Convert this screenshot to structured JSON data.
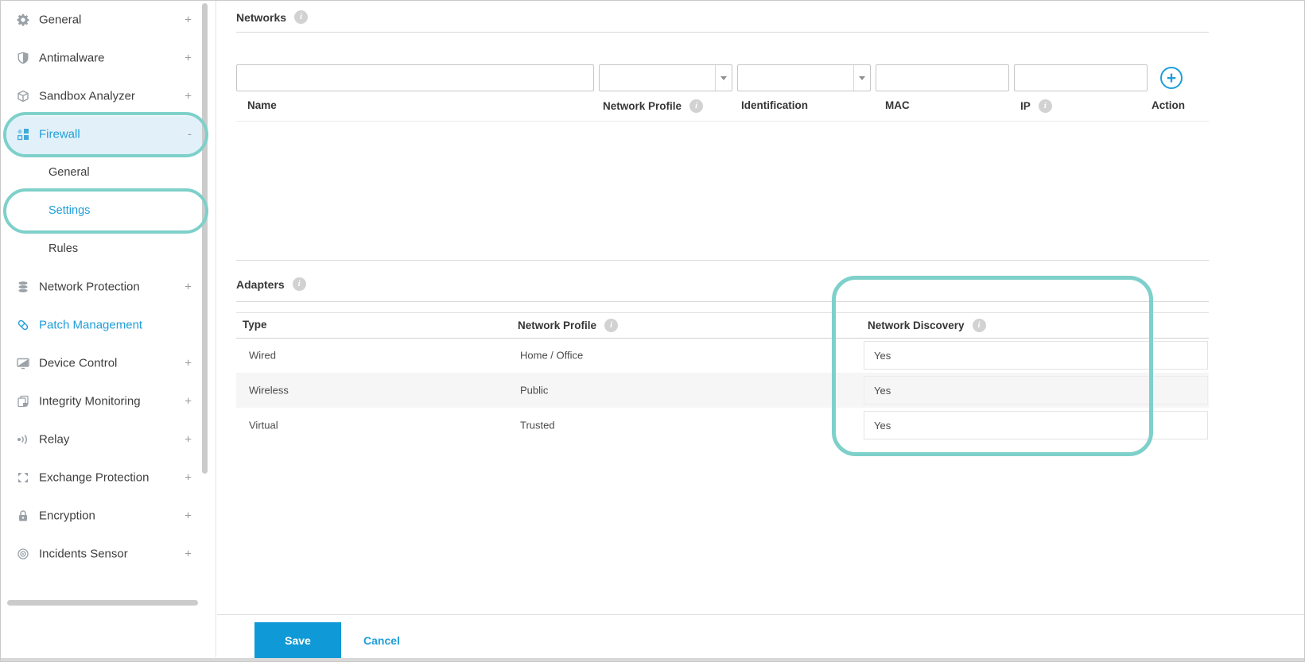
{
  "sidebar": {
    "items_top": [
      {
        "label": "General",
        "icon": "gear-icon",
        "expander": "+"
      },
      {
        "label": "Antimalware",
        "icon": "shield-icon",
        "expander": "+"
      },
      {
        "label": "Sandbox Analyzer",
        "icon": "cube-icon",
        "expander": "+"
      }
    ],
    "firewall": {
      "label": "Firewall",
      "icon": "firewall-icon",
      "expander": "-"
    },
    "firewall_children": [
      {
        "label": "General"
      },
      {
        "label": "Settings"
      },
      {
        "label": "Rules"
      }
    ],
    "items_bottom": [
      {
        "label": "Network Protection",
        "icon": "database-icon",
        "expander": "+"
      },
      {
        "label": "Patch Management",
        "icon": "patch-icon",
        "expander": ""
      },
      {
        "label": "Device Control",
        "icon": "monitor-icon",
        "expander": "+"
      },
      {
        "label": "Integrity Monitoring",
        "icon": "copy-icon",
        "expander": "+"
      },
      {
        "label": "Relay",
        "icon": "signal-icon",
        "expander": "+"
      },
      {
        "label": "Exchange Protection",
        "icon": "exchange-icon",
        "expander": "+"
      },
      {
        "label": "Encryption",
        "icon": "lock-icon",
        "expander": "+"
      },
      {
        "label": "Incidents Sensor",
        "icon": "sensor-icon",
        "expander": "+"
      }
    ]
  },
  "networks": {
    "title": "Networks",
    "headers": {
      "name": "Name",
      "network_profile": "Network Profile",
      "identification": "Identification",
      "mac": "MAC",
      "ip": "IP",
      "action": "Action"
    },
    "filters": {
      "name_value": "",
      "network_profile_value": "",
      "identification_value": "",
      "mac_value": "",
      "ip_value": ""
    }
  },
  "adapters": {
    "title": "Adapters",
    "headers": {
      "type": "Type",
      "network_profile": "Network Profile",
      "network_discovery": "Network Discovery"
    },
    "rows": [
      {
        "type": "Wired",
        "network_profile": "Home / Office",
        "network_discovery": "Yes"
      },
      {
        "type": "Wireless",
        "network_profile": "Public",
        "network_discovery": "Yes"
      },
      {
        "type": "Virtual",
        "network_profile": "Trusted",
        "network_discovery": "Yes"
      }
    ]
  },
  "footer": {
    "save_label": "Save",
    "cancel_label": "Cancel"
  },
  "icons": {
    "info_glyph": "i",
    "plus_glyph": "+"
  },
  "colors": {
    "link_blue": "#1f9ed9",
    "save_blue": "#0f99d6",
    "annotation_teal": "#7ed0ca",
    "active_item_bg": "#e2f1f9",
    "icon_gray": "#9aa1a7"
  }
}
